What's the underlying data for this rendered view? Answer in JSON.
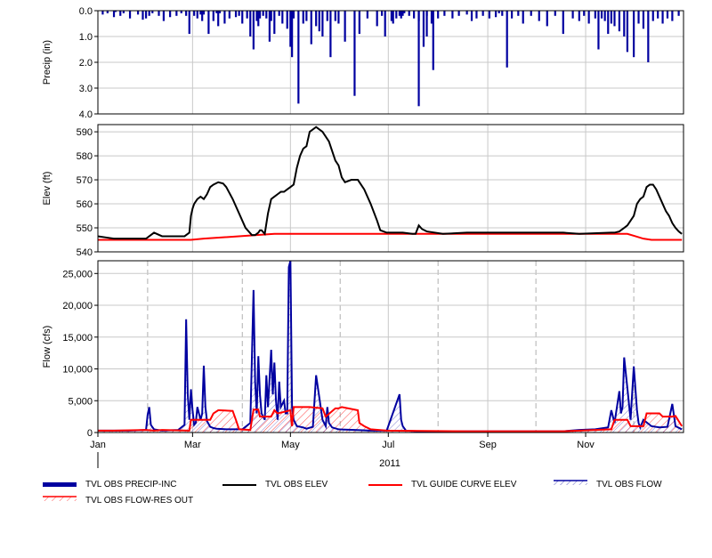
{
  "chart_data": [
    {
      "type": "bar",
      "panel": "precip",
      "ylabel": "Precip (in)",
      "ylim": [
        0,
        4
      ],
      "y_inverted": true,
      "yticks": [
        "0.0",
        "1.0",
        "2.0",
        "3.0",
        "4.0"
      ],
      "yticks_values": [
        0,
        1,
        2,
        3,
        4
      ],
      "series": [
        {
          "name": "TVL OBS PRECIP-INC",
          "color": "#0000a0",
          "x_day": [
            3,
            6,
            10,
            11,
            14,
            16,
            20,
            25,
            28,
            30,
            32,
            34,
            38,
            41,
            45,
            49,
            52,
            55,
            57,
            60,
            62,
            64,
            65,
            66,
            69,
            72,
            74,
            75,
            76,
            79,
            82,
            86,
            88,
            90,
            93,
            95,
            97,
            99,
            100,
            101,
            103,
            105,
            107,
            108,
            110,
            113,
            115,
            118,
            120,
            121,
            122,
            125,
            128,
            130,
            133,
            136,
            138,
            140,
            143,
            145,
            148,
            150,
            154,
            160,
            163,
            168,
            174,
            177,
            179,
            183,
            184,
            186,
            188,
            189,
            190,
            191,
            194,
            197,
            200,
            203,
            205,
            208,
            212,
            216,
            221,
            225,
            230,
            233,
            236,
            240,
            244,
            248,
            250,
            252,
            255,
            258,
            262,
            265,
            270,
            275,
            280,
            285,
            290,
            296,
            300,
            303,
            306,
            310,
            312,
            314,
            316,
            318,
            320,
            322,
            325,
            328,
            330,
            334,
            337,
            340,
            343,
            346,
            349,
            352,
            355,
            358,
            362
          ],
          "values": [
            0.15,
            0.1,
            0.25,
            0.05,
            0.2,
            0.1,
            0.3,
            0.15,
            0.35,
            0.3,
            0.2,
            0.1,
            0.2,
            0.4,
            0.25,
            0.2,
            0.1,
            0.2,
            0.9,
            0.2,
            0.3,
            0.15,
            0.4,
            0.15,
            0.9,
            0.4,
            0.1,
            0.6,
            0.1,
            0.5,
            0.3,
            0.25,
            0.2,
            0.5,
            0.3,
            1.0,
            1.5,
            0.4,
            0.6,
            0.3,
            0.2,
            0.3,
            1.2,
            0.4,
            0.9,
            0.2,
            0.5,
            0.7,
            1.4,
            1.8,
            0.3,
            3.6,
            0.5,
            0.4,
            1.3,
            0.6,
            0.8,
            1.0,
            0.4,
            1.8,
            0.4,
            0.5,
            1.2,
            3.3,
            0.9,
            0.3,
            0.6,
            0.2,
            1.0,
            0.4,
            0.5,
            0.3,
            0.2,
            0.3,
            0.2,
            0.1,
            0.2,
            0.3,
            0.4,
            1.4,
            0.2,
            0.5,
            0.3,
            0.2,
            0.3,
            0.2,
            0.15,
            0.4,
            0.3,
            0.2,
            0.3,
            0.25,
            0.1,
            0.2,
            2.2,
            0.3,
            0.2,
            0.5,
            0.2,
            0.4,
            0.6,
            0.2,
            0.9,
            0.3,
            0.4,
            0.2,
            0.5,
            0.3,
            1.5,
            0.3,
            0.4,
            0.9,
            0.5,
            0.6,
            0.8,
            1.0,
            1.6,
            1.8,
            0.5,
            0.7,
            2.0,
            0.4,
            0.3,
            0.5,
            0.3,
            0.4,
            0.2
          ],
          "extra_x_day": [
            200,
            205,
            209
          ],
          "extra_values": [
            3.7,
            1.0,
            2.3
          ]
        }
      ]
    },
    {
      "type": "line",
      "panel": "elev",
      "ylabel": "Elev (ft)",
      "ylim": [
        540,
        593
      ],
      "yticks": [
        "540",
        "550",
        "560",
        "570",
        "580",
        "590"
      ],
      "yticks_values": [
        540,
        550,
        560,
        570,
        580,
        590
      ],
      "series": [
        {
          "name": "TVL OBS ELEV",
          "color": "#000000",
          "x_day": [
            0,
            5,
            10,
            20,
            30,
            32,
            35,
            40,
            50,
            54,
            57,
            58,
            59,
            60,
            62,
            64,
            66,
            68,
            70,
            72,
            75,
            78,
            80,
            84,
            88,
            92,
            96,
            98,
            100,
            101,
            102,
            104,
            106,
            108,
            110,
            112,
            114,
            116,
            118,
            120,
            122,
            124,
            126,
            128,
            130,
            132,
            136,
            140,
            144,
            146,
            148,
            150,
            152,
            154,
            158,
            162,
            166,
            170,
            174,
            176,
            180,
            190,
            196,
            198,
            200,
            202,
            205,
            215,
            230,
            250,
            270,
            290,
            300,
            320,
            322,
            325,
            326,
            328,
            330,
            332,
            334,
            336,
            338,
            340,
            342,
            344,
            346,
            348,
            350,
            352,
            354,
            356,
            358,
            360,
            362,
            364
          ],
          "values": [
            546.5,
            546,
            545.5,
            545.5,
            545.5,
            546.5,
            548,
            546.5,
            546.5,
            546.5,
            548,
            555,
            558,
            560,
            562,
            563,
            562,
            564,
            567,
            568,
            569,
            568.5,
            567,
            562,
            556,
            550,
            547,
            547,
            548,
            549,
            549,
            547.5,
            556,
            562,
            563,
            564,
            565,
            565,
            566,
            567,
            568,
            575,
            580,
            583,
            584,
            590,
            592,
            590,
            586,
            582,
            578,
            576,
            571,
            569,
            570,
            570,
            566,
            560,
            553,
            549,
            548,
            548,
            547.5,
            547.5,
            551,
            549.5,
            548.5,
            547.5,
            548,
            548,
            548,
            548,
            547.5,
            548,
            548,
            548.5,
            549,
            550,
            551,
            553,
            555,
            560,
            562,
            563,
            567,
            568,
            568,
            566,
            563,
            560,
            557,
            555,
            552,
            550,
            548.5,
            547.5
          ]
        },
        {
          "name": "TVL GUIDE CURVE ELEV",
          "color": "#ff0000",
          "x_day": [
            0,
            40,
            58,
            66,
            110,
            330,
            335,
            340,
            345,
            364
          ],
          "values": [
            545,
            545,
            545,
            545.5,
            547.5,
            547.5,
            546.5,
            545.5,
            545,
            545
          ]
        }
      ]
    },
    {
      "type": "line",
      "panel": "flow",
      "ylabel": "Flow (cfs)",
      "ylim": [
        0,
        27000
      ],
      "yticks": [
        "0",
        "5,000",
        "10,000",
        "15,000",
        "20,000",
        "25,000"
      ],
      "yticks_values": [
        0,
        5000,
        10000,
        15000,
        20000,
        25000
      ],
      "xticks": [
        "Jan",
        "Mar",
        "May",
        "Jul",
        "Sep",
        "Nov"
      ],
      "xticks_day": [
        0,
        59,
        120,
        181,
        243,
        304
      ],
      "xlabel_year": "2011",
      "series": [
        {
          "name": "TVL OBS FLOW",
          "color": "#0000a0",
          "x_day": [
            0,
            20,
            30,
            31,
            32,
            33,
            35,
            40,
            50,
            54,
            55,
            56,
            57,
            58,
            59,
            60,
            61,
            62,
            64,
            65,
            66,
            67,
            68,
            70,
            72,
            74,
            80,
            90,
            95,
            97,
            98,
            99,
            100,
            101,
            102,
            104,
            105,
            106,
            108,
            109,
            110,
            111,
            112,
            113,
            114,
            116,
            117,
            118,
            119,
            120,
            121,
            122,
            124,
            128,
            130,
            134,
            136,
            140,
            142,
            143,
            144,
            146,
            150,
            160,
            170,
            180,
            188,
            189,
            190,
            192,
            200,
            210,
            230,
            260,
            290,
            300,
            310,
            318,
            320,
            322,
            325,
            326,
            327,
            328,
            330,
            332,
            334,
            336,
            337,
            338,
            340,
            345,
            350,
            355,
            358,
            360,
            364
          ],
          "values": [
            300,
            300,
            400,
            2800,
            4000,
            1200,
            500,
            300,
            400,
            1200,
            17800,
            6000,
            2000,
            6800,
            3500,
            1200,
            1500,
            4000,
            2000,
            3000,
            10500,
            4000,
            1800,
            900,
            700,
            600,
            500,
            500,
            1500,
            22400,
            8000,
            3000,
            12000,
            6000,
            3000,
            2000,
            9000,
            4000,
            13000,
            6000,
            11000,
            5000,
            2000,
            8000,
            4000,
            5000,
            3000,
            3000,
            26000,
            27000,
            4000,
            2000,
            1000,
            800,
            600,
            900,
            9000,
            2000,
            1000,
            4000,
            1500,
            800,
            500,
            400,
            300,
            300,
            6000,
            2000,
            1000,
            300,
            200,
            200,
            200,
            200,
            200,
            400,
            500,
            800,
            3500,
            1500,
            6500,
            3000,
            4000,
            11800,
            7000,
            2000,
            10400,
            3500,
            1500,
            800,
            2000,
            1000,
            800,
            900,
            4500,
            1000,
            500
          ]
        },
        {
          "name": "TVL OBS FLOW-RES OUT",
          "color": "#ff0000",
          "x_day": [
            0,
            10,
            30,
            35,
            40,
            57,
            58,
            70,
            72,
            75,
            76,
            84,
            86,
            88,
            95,
            97,
            100,
            101,
            108,
            110,
            112,
            120,
            121,
            122,
            132,
            140,
            142,
            148,
            150,
            152,
            162,
            163,
            166,
            170,
            180,
            230,
            290,
            300,
            320,
            322,
            330,
            332,
            340,
            342,
            350,
            352,
            358,
            360,
            364
          ],
          "values": [
            300,
            300,
            400,
            300,
            400,
            300,
            2000,
            2000,
            3000,
            3500,
            3500,
            3400,
            2000,
            500,
            400,
            3600,
            3600,
            2500,
            2500,
            3500,
            3000,
            3500,
            1000,
            4000,
            4000,
            3800,
            2500,
            3800,
            3800,
            4000,
            3500,
            1500,
            1000,
            500,
            300,
            200,
            200,
            300,
            500,
            2000,
            2000,
            1000,
            1000,
            3000,
            3000,
            2500,
            2500,
            2600,
            1000
          ]
        }
      ]
    }
  ],
  "legend": {
    "items": [
      {
        "label": "TVL OBS PRECIP-INC",
        "color": "#0000a0",
        "style": "thick-bar"
      },
      {
        "label": "TVL OBS ELEV",
        "color": "#000000",
        "style": "line"
      },
      {
        "label": "TVL GUIDE CURVE ELEV",
        "color": "#ff0000",
        "style": "line"
      },
      {
        "label": "TVL OBS FLOW",
        "color": "#0000a0",
        "style": "hatch-line"
      },
      {
        "label": "TVL OBS FLOW-RES OUT",
        "color": "#ff0000",
        "style": "hatch-line"
      }
    ]
  }
}
